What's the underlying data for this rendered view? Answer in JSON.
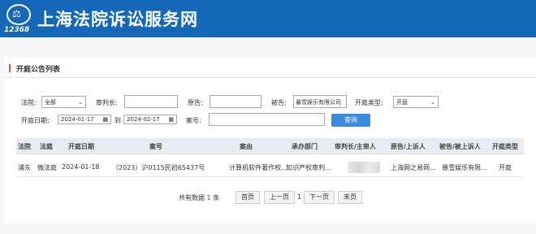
{
  "header": {
    "logo_number": "12368",
    "title": "上海法院诉讼服务网"
  },
  "panel": {
    "title": "开庭公告列表"
  },
  "filters": {
    "court_label": "法院:",
    "court_value": "全部",
    "judge_label": "审判长:",
    "judge_value": "",
    "plaintiff_label": "原告:",
    "plaintiff_value": "",
    "defendant_label": "被告:",
    "defendant_value": "暴雪娱乐有限公司",
    "type_label": "开庭类型:",
    "type_value": "开庭",
    "date_label": "开庭日期:",
    "date_from": "2024-01-17",
    "date_to_label": "到",
    "date_to": "2024-02-17",
    "case_label": "案号:",
    "case_value": "",
    "query_button": "查询"
  },
  "table": {
    "headers": [
      "法院",
      "法庭",
      "开庭日期",
      "案号",
      "案由",
      "承办部门",
      "审判长/主审人",
      "原告/上诉人",
      "被告/被上诉人",
      "开庭类型"
    ],
    "rows": [
      {
        "court": "浦东",
        "room": "微法庭",
        "date": "2024-01-18",
        "case_no": "（2023）沪0115民初65437号",
        "cause": "计算机软件著作权...",
        "dept": "知识产权审判...",
        "judge": "",
        "plaintiff": "上海网之易网...",
        "defendant": "暴雪娱乐有限...",
        "type": "开庭"
      }
    ]
  },
  "pager": {
    "total_prefix": "共有数据",
    "total": "1",
    "total_suffix": "条",
    "first": "首页",
    "prev": "上一页",
    "current": "1",
    "next": "下一页",
    "last": "末页"
  }
}
